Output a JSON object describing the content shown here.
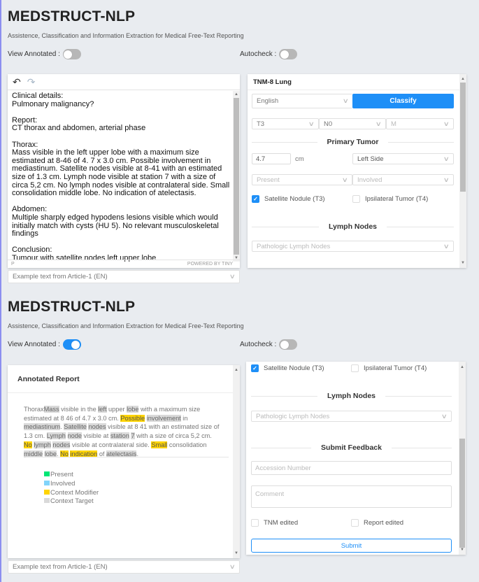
{
  "app": {
    "title": "MEDSTRUCT-NLP",
    "subtitle": "Assistence, Classification and Information Extraction for Medical Free-Text Reporting"
  },
  "colors": {
    "accent": "#1e8ff7",
    "present": "#00e676",
    "involved": "#81d4fa",
    "context_modifier": "#ffd400",
    "context_target": "#d9d9d9"
  },
  "view1": {
    "view_annotated_label": "View Annotated :",
    "view_annotated_on": false,
    "autocheck_label": "Autocheck :",
    "autocheck_on": false,
    "editor": {
      "undo_icon": "↶",
      "redo_icon": "↷",
      "content": "Clinical details:\nPulmonary malignancy?\n\nReport:\nCT thorax and abdomen, arterial phase\n\nThorax:\nMass visible in the left upper lobe with a maximum size estimated at 8-46 of 4. 7 x 3.0 cm. Possible involvement in mediastinum. Satellite nodes visible at 8-41 with an estimated size of 1.3 cm. Lymph node visible at station 7 with a size of circa 5,2 cm. No lymph nodes visible at contralateral side. Small consolidation middle lobe. No indication of atelectasis.\n\nAbdomen:\nMultiple sharply edged hypodens lesions visible which would initially match with cysts (HU 5). No relevant musculoskeletal findings\n\nConclusion:\nTumour with satellite nodes left upper lobe",
      "status_path": "P",
      "powered_by": "POWERED BY TINY"
    },
    "example_select": "Example text from Article-1 (EN)",
    "tnm_panel": {
      "title": "TNM-8 Lung",
      "language": "English",
      "classify_label": "Classify",
      "t_value": "T3",
      "n_value": "N0",
      "m_placeholder": "M",
      "primary_tumor_heading": "Primary Tumor",
      "size_value": "4.7",
      "size_unit": "cm",
      "side_value": "Left Side",
      "present_placeholder": "Present",
      "involved_placeholder": "Involved",
      "satellite_label": "Satellite Nodule (T3)",
      "satellite_checked": true,
      "ipsilateral_label": "Ipsilateral Tumor (T4)",
      "ipsilateral_checked": false,
      "lymph_heading": "Lymph Nodes",
      "lymph_placeholder": "Pathologic Lymph Nodes"
    }
  },
  "view2": {
    "view_annotated_label": "View Annotated :",
    "view_annotated_on": true,
    "autocheck_label": "Autocheck :",
    "autocheck_on": false,
    "annotated": {
      "title": "Annotated Report",
      "segments": [
        {
          "t": "Thorax",
          "c": ""
        },
        {
          "t": "Mass",
          "c": "target"
        },
        {
          "t": " visible in the ",
          "c": ""
        },
        {
          "t": "left",
          "c": "target"
        },
        {
          "t": " upper ",
          "c": ""
        },
        {
          "t": "lobe",
          "c": "target"
        },
        {
          "t": " with a maximum size estimated at 8 46 of 4.7 x 3.0 cm. ",
          "c": ""
        },
        {
          "t": "Possible",
          "c": "mod"
        },
        {
          "t": " ",
          "c": ""
        },
        {
          "t": "involvement",
          "c": "target"
        },
        {
          "t": " in ",
          "c": ""
        },
        {
          "t": "mediastinum",
          "c": "target"
        },
        {
          "t": ". ",
          "c": ""
        },
        {
          "t": "Satellite",
          "c": "target"
        },
        {
          "t": " ",
          "c": ""
        },
        {
          "t": "nodes",
          "c": "target"
        },
        {
          "t": " visible at 8 41 with an estimated size of 1.3 cm. ",
          "c": ""
        },
        {
          "t": "Lymph",
          "c": "target"
        },
        {
          "t": " ",
          "c": ""
        },
        {
          "t": "node",
          "c": "target"
        },
        {
          "t": " visible at ",
          "c": ""
        },
        {
          "t": "station",
          "c": "target"
        },
        {
          "t": " ",
          "c": ""
        },
        {
          "t": "7",
          "c": "target"
        },
        {
          "t": " with a size of circa 5,2 cm. ",
          "c": ""
        },
        {
          "t": "No",
          "c": "mod"
        },
        {
          "t": " ",
          "c": ""
        },
        {
          "t": "lymph",
          "c": "target"
        },
        {
          "t": " ",
          "c": ""
        },
        {
          "t": "nodes",
          "c": "target"
        },
        {
          "t": " visible at contralateral side. ",
          "c": ""
        },
        {
          "t": "Small",
          "c": "mod"
        },
        {
          "t": " consolidation ",
          "c": ""
        },
        {
          "t": "middle",
          "c": "target"
        },
        {
          "t": " ",
          "c": ""
        },
        {
          "t": "lobe",
          "c": "target"
        },
        {
          "t": ". ",
          "c": ""
        },
        {
          "t": "No",
          "c": "mod"
        },
        {
          "t": " ",
          "c": ""
        },
        {
          "t": "indication",
          "c": "mod"
        },
        {
          "t": " of ",
          "c": ""
        },
        {
          "t": "atelectasis",
          "c": "target"
        },
        {
          "t": ".",
          "c": ""
        }
      ],
      "legend": [
        {
          "label": "Present",
          "color": "#00e676"
        },
        {
          "label": "Involved",
          "color": "#81d4fa"
        },
        {
          "label": "Context Modifier",
          "color": "#ffd400"
        },
        {
          "label": "Context Target",
          "color": "#d9d9d9"
        }
      ]
    },
    "example_select": "Example text from Article-1 (EN)",
    "tnm_panel": {
      "satellite_label": "Satellite Nodule (T3)",
      "satellite_checked": true,
      "ipsilateral_label": "Ipsilateral Tumor (T4)",
      "ipsilateral_checked": false,
      "lymph_heading": "Lymph Nodes",
      "lymph_placeholder": "Pathologic Lymph Nodes",
      "feedback_heading": "Submit Feedback",
      "accession_placeholder": "Accession Number",
      "comment_placeholder": "Comment",
      "tnm_edited_label": "TNM edited",
      "report_edited_label": "Report edited",
      "submit_label": "Submit"
    }
  }
}
